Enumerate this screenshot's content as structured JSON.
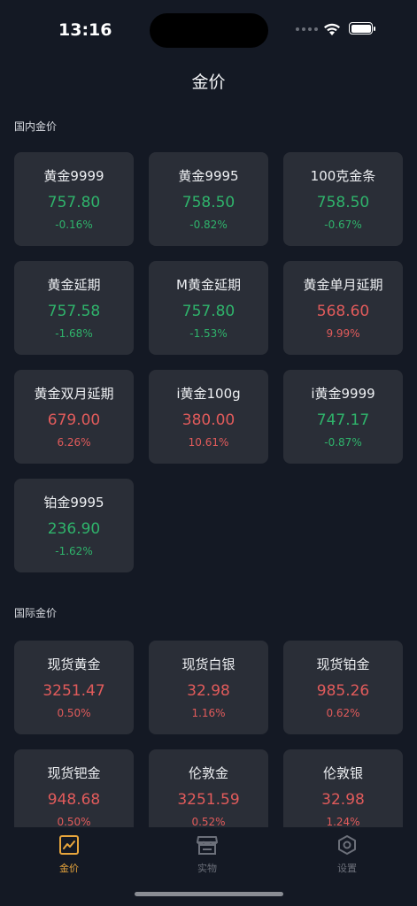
{
  "status_bar": {
    "time": "13:16"
  },
  "nav": {
    "title": "金价"
  },
  "domestic": {
    "title": "国内金价",
    "items": [
      {
        "name": "黄金9999",
        "price": "757.80",
        "change": "-0.16%",
        "trend": "down"
      },
      {
        "name": "黄金9995",
        "price": "758.50",
        "change": "-0.82%",
        "trend": "down"
      },
      {
        "name": "100克金条",
        "price": "758.50",
        "change": "-0.67%",
        "trend": "down"
      },
      {
        "name": "黄金延期",
        "price": "757.58",
        "change": "-1.68%",
        "trend": "down"
      },
      {
        "name": "M黄金延期",
        "price": "757.80",
        "change": "-1.53%",
        "trend": "down"
      },
      {
        "name": "黄金单月延期",
        "price": "568.60",
        "change": "9.99%",
        "trend": "up"
      },
      {
        "name": "黄金双月延期",
        "price": "679.00",
        "change": "6.26%",
        "trend": "up"
      },
      {
        "name": "i黄金100g",
        "price": "380.00",
        "change": "10.61%",
        "trend": "up"
      },
      {
        "name": "i黄金9999",
        "price": "747.17",
        "change": "-0.87%",
        "trend": "down"
      },
      {
        "name": "铂金9995",
        "price": "236.90",
        "change": "-1.62%",
        "trend": "down"
      }
    ]
  },
  "international": {
    "title": "国际金价",
    "items": [
      {
        "name": "现货黄金",
        "price": "3251.47",
        "change": "0.50%",
        "trend": "up"
      },
      {
        "name": "现货白银",
        "price": "32.98",
        "change": "1.16%",
        "trend": "up"
      },
      {
        "name": "现货铂金",
        "price": "985.26",
        "change": "0.62%",
        "trend": "up"
      },
      {
        "name": "现货钯金",
        "price": "948.68",
        "change": "0.50%",
        "trend": "up"
      },
      {
        "name": "伦敦金",
        "price": "3251.59",
        "change": "0.52%",
        "trend": "up"
      },
      {
        "name": "伦敦银",
        "price": "32.98",
        "change": "1.24%",
        "trend": "up"
      }
    ]
  },
  "tabbar": {
    "tabs": [
      {
        "label": "金价",
        "icon": "chart-icon",
        "active": true
      },
      {
        "label": "实物",
        "icon": "store-icon",
        "active": false
      },
      {
        "label": "设置",
        "icon": "gear-icon",
        "active": false
      }
    ]
  },
  "colors": {
    "up": "#e15b5b",
    "down": "#2fb36b",
    "accent": "#e7a53c",
    "background": "#141924",
    "card": "#2a2e37"
  }
}
